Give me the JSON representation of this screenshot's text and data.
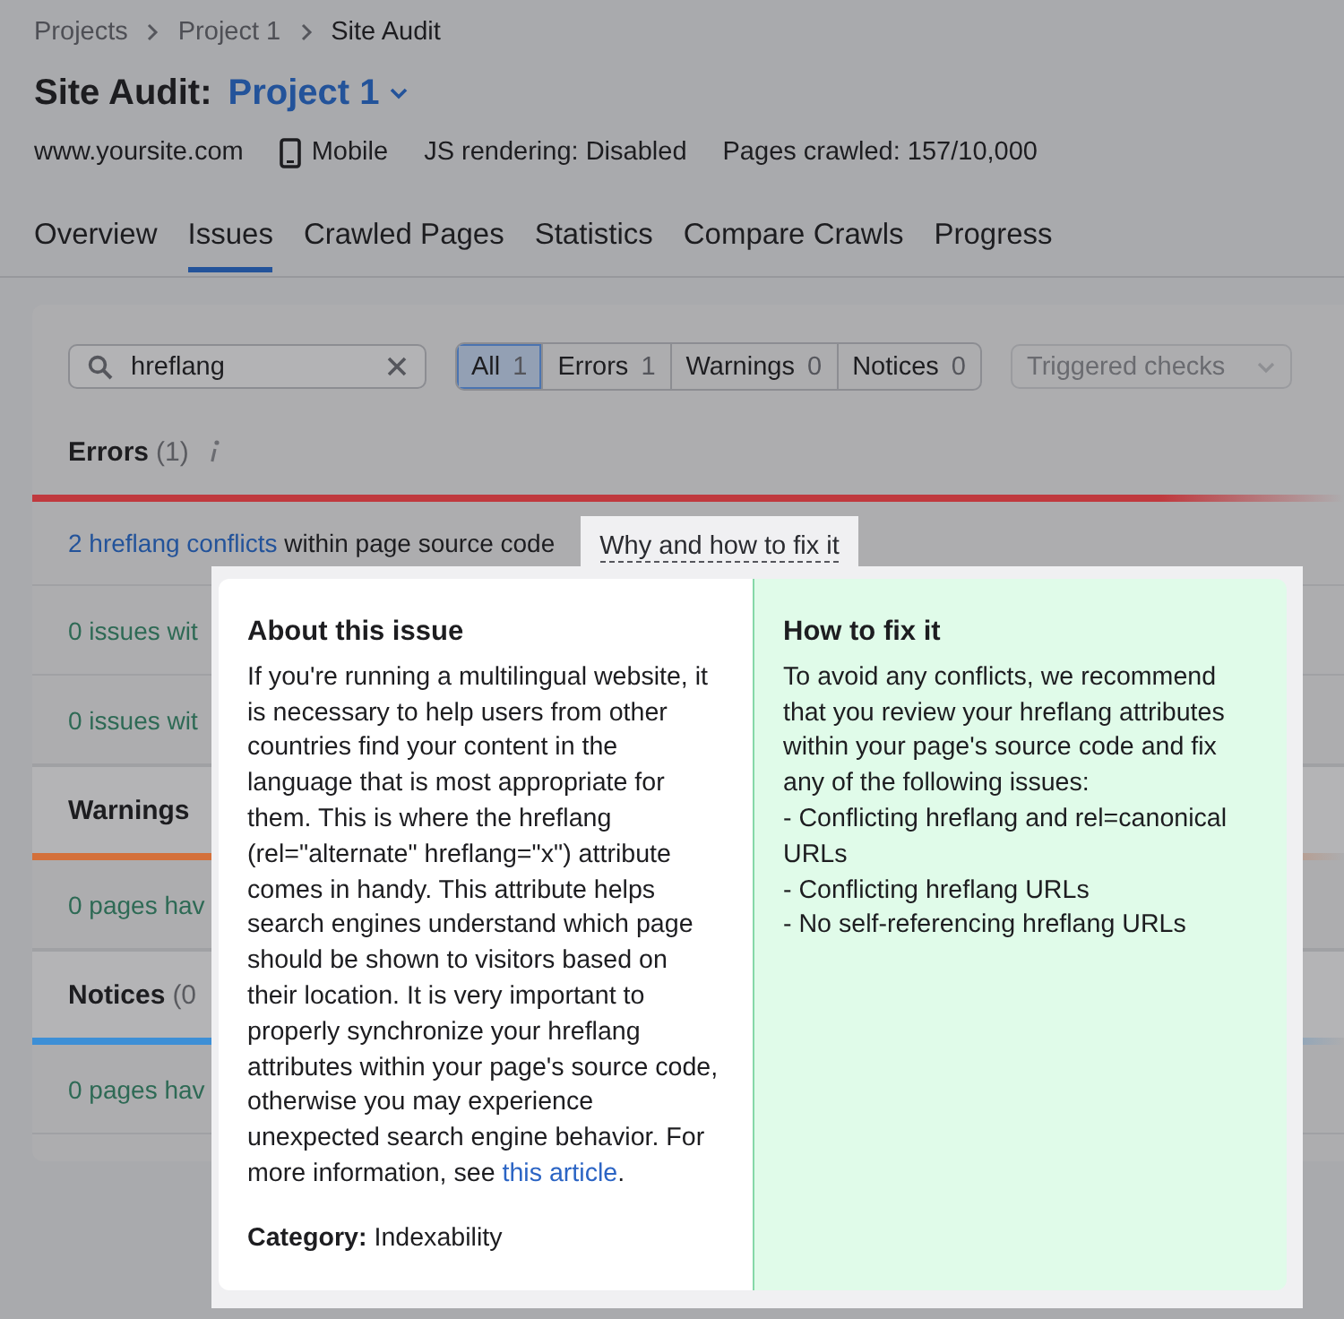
{
  "breadcrumbs": [
    {
      "label": "Projects",
      "current": false
    },
    {
      "label": "Project 1",
      "current": false
    },
    {
      "label": "Site Audit",
      "current": true
    }
  ],
  "title": {
    "prefix": "Site Audit:",
    "project": "Project 1"
  },
  "meta": {
    "site": "www.yoursite.com",
    "device": "Mobile",
    "rendering": "JS rendering: Disabled",
    "pages": "Pages crawled: 157/10,000"
  },
  "tabs": [
    {
      "label": "Overview",
      "selected": false
    },
    {
      "label": "Issues",
      "selected": true
    },
    {
      "label": "Crawled Pages",
      "selected": false
    },
    {
      "label": "Statistics",
      "selected": false
    },
    {
      "label": "Compare Crawls",
      "selected": false
    },
    {
      "label": "Progress",
      "selected": false
    }
  ],
  "filters": {
    "search": {
      "value": "hreflang"
    },
    "segments": [
      {
        "label": "All",
        "count": "1",
        "selected": true
      },
      {
        "label": "Errors",
        "count": "1",
        "selected": false
      },
      {
        "label": "Warnings",
        "count": "0",
        "selected": false
      },
      {
        "label": "Notices",
        "count": "0",
        "selected": false
      }
    ],
    "dropdown": {
      "placeholder": "Triggered checks"
    }
  },
  "sections": [
    {
      "title": "Errors",
      "count": "(1)",
      "info": true,
      "color": "#c0393e",
      "rows": [
        {
          "link": "2 hreflang conflicts",
          "text": " within page source code",
          "action": "Why and how to fix it"
        },
        {
          "text": "0 issues wit"
        },
        {
          "text": "0 issues wit"
        }
      ]
    },
    {
      "title": "Warnings",
      "color": "#d4703a",
      "rows": [
        {
          "text": "0 pages hav"
        }
      ]
    },
    {
      "title": "Notices",
      "count": "(0",
      "color": "#3d8fd6",
      "rows": [
        {
          "text": "0 pages hav"
        }
      ]
    }
  ],
  "popover": {
    "about": {
      "title": "About this issue",
      "before": "If you're running a multilingual website, it is necessary to help users from other countries find your content in the language that is most appropriate for them. This is where the hreflang (rel=\"alternate\" hreflang=\"x\") attribute comes in handy. This attribute helps search engines understand which page should be shown to visitors based on their location. It is very important to properly synchronize your hreflang attributes within your page's source code, otherwise you may experience unexpected search engine behavior. For more information, see ",
      "link": "this article",
      "after": ".",
      "category_label": "Category:",
      "category": "Indexability"
    },
    "fix": {
      "title": "How to fix it",
      "intro": "To avoid any conflicts, we recommend that you review your hreflang attributes within your page's source code and fix any of the following issues:",
      "items": [
        "- Conflicting hreflang and rel=canonical URLs",
        "- Conflicting hreflang URLs",
        "- No self-referencing hreflang URLs"
      ]
    }
  }
}
